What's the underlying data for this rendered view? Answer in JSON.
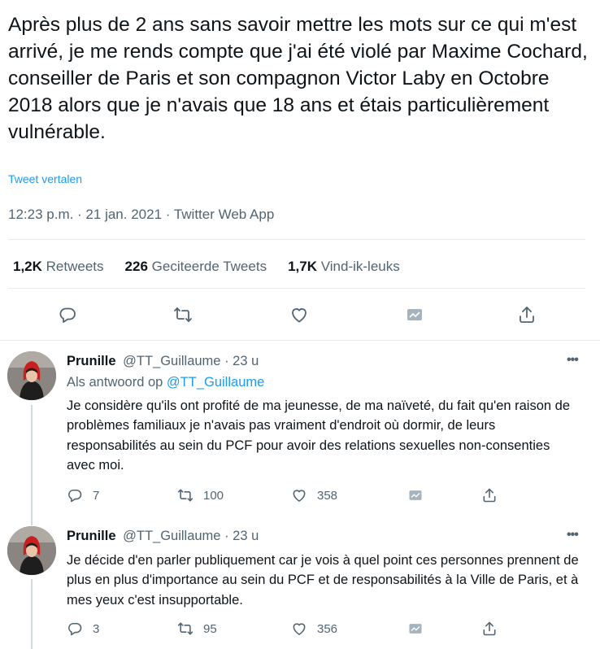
{
  "tweet": {
    "text": "Après plus de 2 ans sans savoir mettre les mots sur ce qui m'est arrivé, je me rends compte que j'ai été violé par Maxime Cochard, conseiller de Paris et son compagnon Victor Laby en Octobre 2018 alors que je n'avais que 18 ans et étais particulièrement vulnérable.",
    "translate_link": "Tweet vertalen",
    "timestamp": "12:23 p.m. · 21 jan. 2021 · Twitter Web App",
    "stats": {
      "retweets_count": "1,2K",
      "retweets_label": "Retweets",
      "quotes_count": "226",
      "quotes_label": "Geciteerde Tweets",
      "likes_count": "1,7K",
      "likes_label": "Vind-ik-leuks"
    }
  },
  "replies": [
    {
      "name": "Prunille",
      "handle": "@TT_Guillaume",
      "time": "· 23 u",
      "reply_prefix": "Als antwoord op",
      "reply_to": "@TT_Guillaume",
      "text": "Je considère qu'ils ont profité de ma jeunesse, de ma naïveté, du fait qu'en raison de problèmes familiaux je n'avais pas vraiment d'endroit où dormir, de leurs responsabilités au sein du PCF pour avoir des relations sexuelles non-consenties avec moi.",
      "replies_count": "7",
      "retweets_count": "100",
      "likes_count": "358"
    },
    {
      "name": "Prunille",
      "handle": "@TT_Guillaume",
      "time": "· 23 u",
      "text": "Je décide d'en parler publiquement car je vois à quel point ces personnes prennent de plus en plus d'importance au sein du PCF et de responsabilités à la Ville de Paris, et à mes yeux c'est insupportable.",
      "replies_count": "3",
      "retweets_count": "95",
      "likes_count": "356"
    }
  ],
  "more_glyph": "•••",
  "colors": {
    "accent": "#1d9bf0",
    "secondary_text": "#536471",
    "divider": "#e6ecf0"
  },
  "icons": [
    "reply-icon",
    "retweet-icon",
    "like-icon",
    "analytics-icon",
    "share-icon",
    "more-icon"
  ]
}
